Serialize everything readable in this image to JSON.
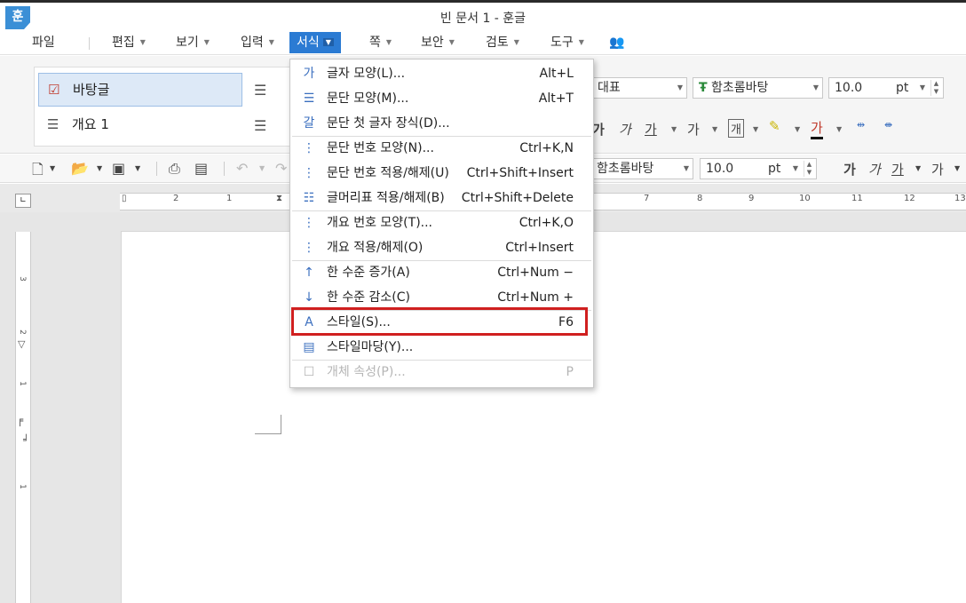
{
  "window": {
    "app_icon": "훈",
    "title": "빈 문서 1 - 훈글"
  },
  "menubar": {
    "items": [
      {
        "label": "파일"
      },
      {
        "label": "편집"
      },
      {
        "label": "보기"
      },
      {
        "label": "입력"
      },
      {
        "label": "서식"
      },
      {
        "label": "쪽"
      },
      {
        "label": "보안"
      },
      {
        "label": "검토"
      },
      {
        "label": "도구"
      }
    ],
    "active": "서식"
  },
  "ribbon": {
    "styles": [
      {
        "label": "바탕글"
      },
      {
        "label": "개요 1"
      }
    ],
    "style_combo": "대표",
    "font_combo": "함초롬바탕",
    "size_value": "10.0",
    "size_unit": "pt",
    "format_buttons": [
      "가",
      "가",
      "가",
      "가",
      "개",
      "가"
    ]
  },
  "toolbar2": {
    "font_combo": "함초롬바탕",
    "size_value": "10.0",
    "size_unit": "pt"
  },
  "ruler": {
    "h_numbers": [
      "2",
      "1",
      "7",
      "8",
      "9",
      "10",
      "11",
      "12",
      "13"
    ],
    "v_numbers": [
      "3",
      "2",
      "1",
      "1"
    ]
  },
  "format_menu": {
    "items": [
      {
        "icon": "char-shape-icon",
        "label": "글자 모양(L)...",
        "shortcut": "Alt+L",
        "disabled": false
      },
      {
        "icon": "para-shape-icon",
        "label": "문단 모양(M)...",
        "shortcut": "Alt+T",
        "disabled": false
      },
      {
        "icon": "drop-cap-icon",
        "label": "문단 첫 글자 장식(D)...",
        "shortcut": "",
        "disabled": false
      },
      {
        "icon": "para-number-icon",
        "label": "문단 번호 모양(N)...",
        "shortcut": "Ctrl+K,N",
        "disabled": false
      },
      {
        "icon": "para-number-apply-icon",
        "label": "문단 번호 적용/해제(U)",
        "shortcut": "Ctrl+Shift+Insert",
        "disabled": false
      },
      {
        "icon": "bullet-icon",
        "label": "글머리표 적용/해제(B)",
        "shortcut": "Ctrl+Shift+Delete",
        "disabled": false
      },
      {
        "icon": "outline-number-icon",
        "label": "개요 번호 모양(T)...",
        "shortcut": "Ctrl+K,O",
        "disabled": false
      },
      {
        "icon": "outline-apply-icon",
        "label": "개요 적용/해제(O)",
        "shortcut": "Ctrl+Insert",
        "disabled": false
      },
      {
        "icon": "level-up-icon",
        "label": "한 수준 증가(A)",
        "shortcut": "Ctrl+Num −",
        "disabled": false
      },
      {
        "icon": "level-down-icon",
        "label": "한 수준 감소(C)",
        "shortcut": "Ctrl+Num +",
        "disabled": false
      },
      {
        "icon": "style-icon",
        "label": "스타일(S)...",
        "shortcut": "F6",
        "disabled": false
      },
      {
        "icon": "style-gallery-icon",
        "label": "스타일마당(Y)...",
        "shortcut": "",
        "disabled": false
      },
      {
        "icon": "object-props-icon",
        "label": "개체 속성(P)...",
        "shortcut": "P",
        "disabled": true
      }
    ],
    "highlighted": "스타일(S)..."
  },
  "colors": {
    "accent": "#2b7bd3",
    "highlight_border": "#d01f1f"
  }
}
